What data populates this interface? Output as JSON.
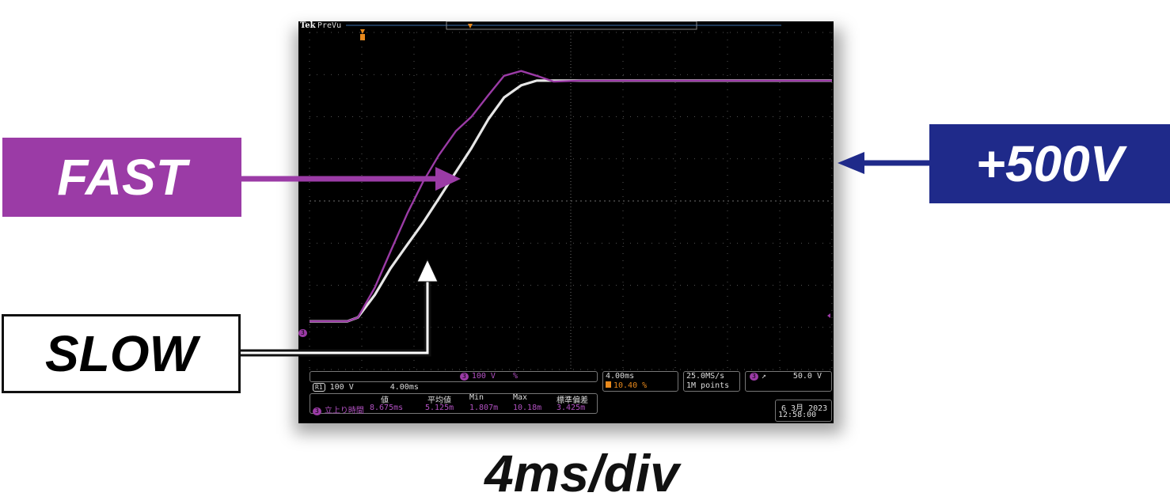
{
  "labels": {
    "fast": "FAST",
    "slow": "SLOW",
    "voltage": "+500V",
    "timebase": "4ms/div"
  },
  "colors": {
    "fast": "#9b3ba6",
    "slow": "#ffffff",
    "voltage": "#1f2a8a",
    "grid": "#6e6e6e",
    "trigger": "#e8891c"
  },
  "scope": {
    "brand": "Tek",
    "mode": "PreVu",
    "channel_marker": "3",
    "ch3_scale": "100 V",
    "ch3_unit": "%",
    "ref_label": "R1",
    "ref_scale": "100 V",
    "ref_time": "4.00ms",
    "horiz_time": "4.00ms",
    "horiz_pos": "10.40 %",
    "sample_rate": "25.0MS/s",
    "record_length": "1M points",
    "trig_channel": "3",
    "trig_slope": "↗",
    "trig_level": "50.0 V",
    "date": "6 3月 2023",
    "time": "12:58:00",
    "measure": {
      "headers": [
        "値",
        "平均値",
        "Min",
        "Max",
        "標準偏差"
      ],
      "channel": "3",
      "name": "立上り時間",
      "values": [
        "8.675ms",
        "5.125m",
        "1.807m",
        "10.18m",
        "3.425m"
      ]
    }
  },
  "chart_data": {
    "type": "line",
    "title": "",
    "xlabel": "4ms/div",
    "ylabel": "",
    "x_unit": "ms",
    "y_unit": "V",
    "xlim": [
      -8.7,
      31.3
    ],
    "ylim": [
      -100,
      600
    ],
    "series": [
      {
        "name": "FAST",
        "x": [
          -8.7,
          -5.8,
          -5.0,
          -3.7,
          -2.5,
          -1.2,
          0.0,
          1.2,
          2.5,
          3.7,
          5.0,
          6.2,
          7.5,
          8.7,
          10.0,
          12.0,
          15.0,
          20.0,
          25.0,
          31.3
        ],
        "y": [
          0,
          0,
          8,
          70,
          145,
          225,
          290,
          345,
          395,
          425,
          470,
          510,
          520,
          510,
          498,
          500,
          500,
          500,
          500,
          500
        ]
      },
      {
        "name": "SLOW",
        "x": [
          -8.7,
          -5.8,
          -5.0,
          -3.7,
          -2.5,
          -1.2,
          0.0,
          1.2,
          2.5,
          3.7,
          5.0,
          6.2,
          7.5,
          8.7,
          10.0,
          12.0,
          15.0,
          20.0,
          25.0,
          31.3
        ],
        "y": [
          0,
          0,
          8,
          55,
          110,
          160,
          205,
          255,
          310,
          360,
          420,
          465,
          490,
          500,
          500,
          500,
          500,
          500,
          500,
          500
        ]
      }
    ]
  }
}
